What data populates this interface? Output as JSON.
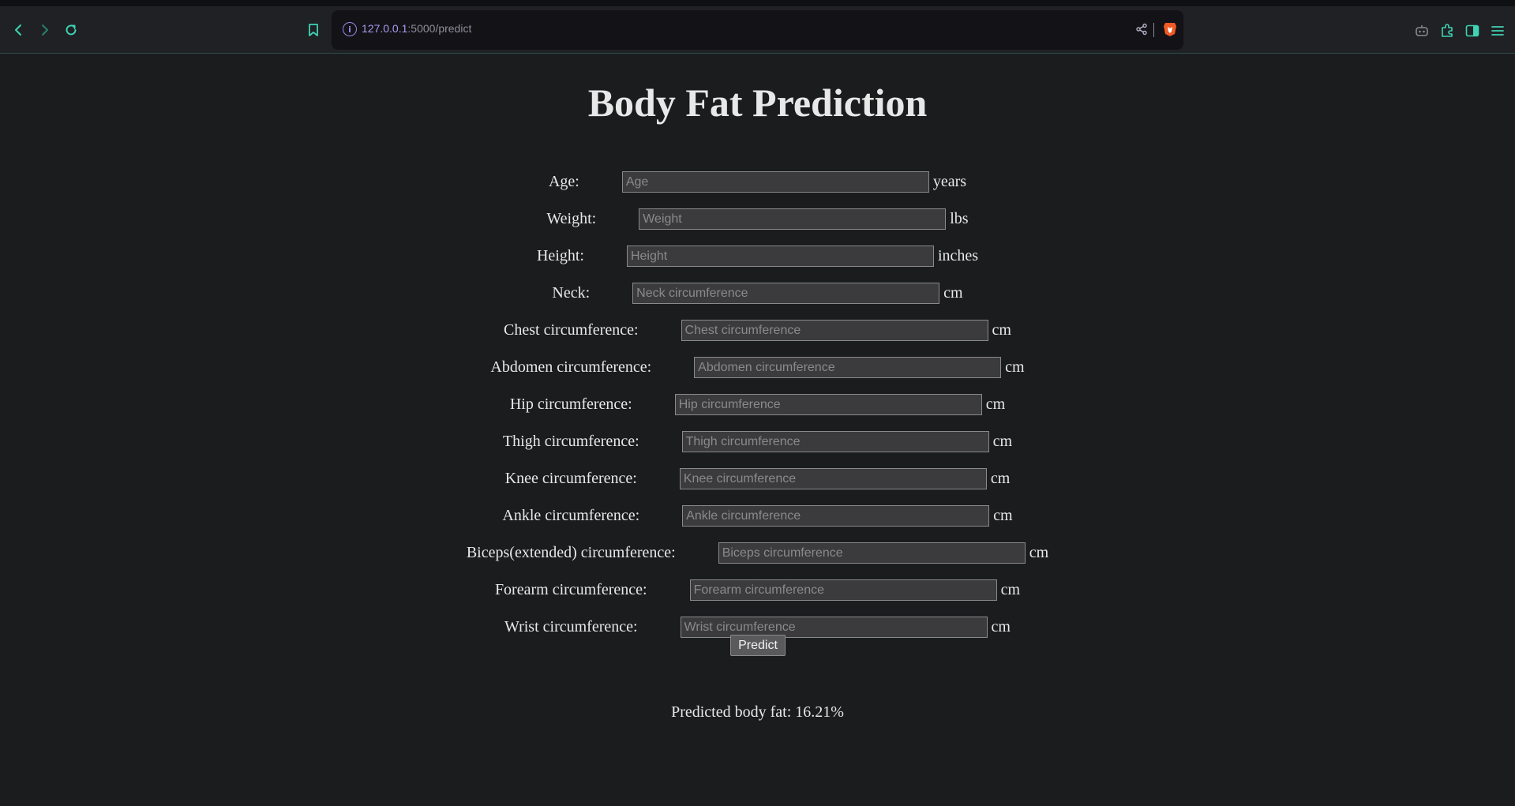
{
  "browser": {
    "url_host": "127.0.0.1",
    "url_path": ":5000/predict",
    "nav": {
      "back_icon": "‹",
      "forward_icon": "›",
      "reload_icon": "⟳"
    },
    "accent_color": "#3fd3b4"
  },
  "page": {
    "title": "Body Fat Prediction",
    "fields": [
      {
        "label": "Age:",
        "placeholder": "Age",
        "unit": "years"
      },
      {
        "label": "Weight:",
        "placeholder": "Weight",
        "unit": "lbs"
      },
      {
        "label": "Height:",
        "placeholder": "Height",
        "unit": "inches"
      },
      {
        "label": "Neck:",
        "placeholder": "Neck circumference",
        "unit": "cm"
      },
      {
        "label": "Chest circumference:",
        "placeholder": "Chest circumference",
        "unit": "cm"
      },
      {
        "label": "Abdomen circumference:",
        "placeholder": "Abdomen circumference",
        "unit": "cm"
      },
      {
        "label": "Hip circumference:",
        "placeholder": "Hip circumference",
        "unit": "cm"
      },
      {
        "label": "Thigh circumference:",
        "placeholder": "Thigh circumference",
        "unit": "cm"
      },
      {
        "label": "Knee circumference:",
        "placeholder": "Knee circumference",
        "unit": "cm"
      },
      {
        "label": "Ankle circumference:",
        "placeholder": "Ankle circumference",
        "unit": "cm"
      },
      {
        "label": "Biceps(extended) circumference:",
        "placeholder": "Biceps circumference",
        "unit": "cm"
      },
      {
        "label": "Forearm circumference:",
        "placeholder": "Forearm circumference",
        "unit": "cm"
      },
      {
        "label": "Wrist circumference:",
        "placeholder": "Wrist circumference",
        "unit": "cm"
      }
    ],
    "predict_label": "Predict",
    "result_text": "Predicted body fat: 16.21%"
  }
}
